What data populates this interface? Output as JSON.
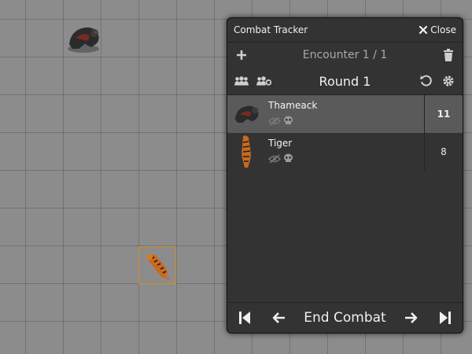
{
  "tracker": {
    "title": "Combat Tracker",
    "close_label": "Close",
    "encounter_label": "Encounter 1 / 1",
    "round_label": "Round 1",
    "end_combat_label": "End Combat",
    "combatants": [
      {
        "name": "Thameack",
        "initiative": "11",
        "active": true
      },
      {
        "name": "Tiger",
        "initiative": "8",
        "active": false
      }
    ]
  },
  "colors": {
    "panel_bg": "#333333",
    "active_row_bg": "#5a5a5a",
    "canvas_bg": "#8c8c8c",
    "token_highlight": "#d58a2a"
  },
  "icons": [
    "close-icon",
    "plus-icon",
    "trash-icon",
    "users-icon",
    "users-cog-icon",
    "undo-icon",
    "gear-icon",
    "eye-slash-icon",
    "skull-icon",
    "first-turn-icon",
    "arrow-left-icon",
    "arrow-right-icon",
    "last-turn-icon"
  ]
}
